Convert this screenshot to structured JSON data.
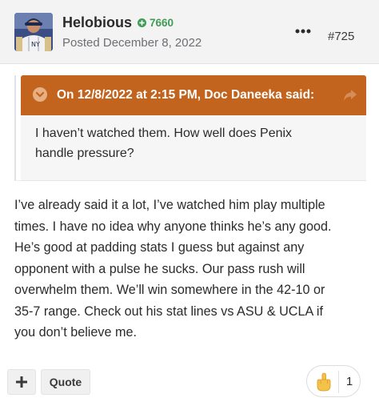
{
  "author": {
    "name": "Helobious",
    "reputation": "7660",
    "posted": "Posted December 8, 2022",
    "avatar": "baseball-player-avatar"
  },
  "post_number": "#725",
  "quote": {
    "citation": "On 12/8/2022 at 2:15 PM, Doc Daneeka said:",
    "lines": [
      "I haven’t watched them. How well does Penix",
      "handle pressure?"
    ]
  },
  "body_lines": [
    "I’ve already said it a lot, I’ve watched him play multiple",
    "times. I have no idea why anyone thinks he’s any good.",
    "He’s good at padding stats I guess but against any",
    "opponent with a pulse he sucks. Our pass rush will",
    "overwhelm them. We’ll win somewhere in the 42-10 or",
    "35-7 range. Check out his stat lines vs ASU & UCLA if",
    "you don’t believe me."
  ],
  "actions": {
    "plus_label": "+",
    "quote_label": "Quote"
  },
  "reaction": {
    "icon": "middle-finger-emoji",
    "count": "1"
  },
  "colors": {
    "quote_header": "#c2631e",
    "reputation": "#3f9b55",
    "header_bg": "#f3f3f4"
  }
}
